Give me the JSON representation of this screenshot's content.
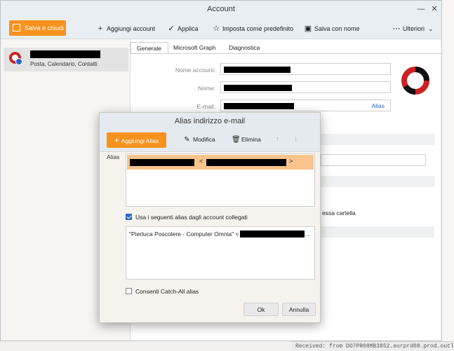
{
  "window": {
    "title": "Account",
    "minimize": "—",
    "close": "✕"
  },
  "toolbar": {
    "save_close": "Salva e chiudi",
    "add_account": "Aggiungi account",
    "apply": "Applica",
    "set_default": "Imposta come predefinito",
    "save_as": "Salva con nome",
    "more": "Ulteriori"
  },
  "account_list": {
    "subtitle": "Posta, Calendario, Contatti"
  },
  "tabs": [
    "Generale",
    "Microsoft Graph",
    "Diagnostica"
  ],
  "fields": {
    "account_name": "Nome account:",
    "name": "Nome:",
    "email": "E-mail:",
    "alias_link": "Alias"
  },
  "background_text": {
    "folder": "essa cartella",
    "status": "Received: from DO7PR08MB3852.eurprd08.prod.outlook"
  },
  "dialog": {
    "title": "Alias indirizzo e-mail",
    "add_alias": "Aggiungi Alias",
    "edit": "Modifica",
    "delete": "Elimina",
    "alias_label": "Alias",
    "alias_open": "<",
    "alias_close": ">",
    "use_linked": "Usa i seguenti alias dagli account collegati",
    "linked_entry": "\"Pierluca Poscolere - Computer Omnia\" <",
    "linked_ellipsis": "...",
    "catch_all": "Consenti Catch-All alias",
    "ok": "Ok",
    "cancel": "Annulla"
  }
}
